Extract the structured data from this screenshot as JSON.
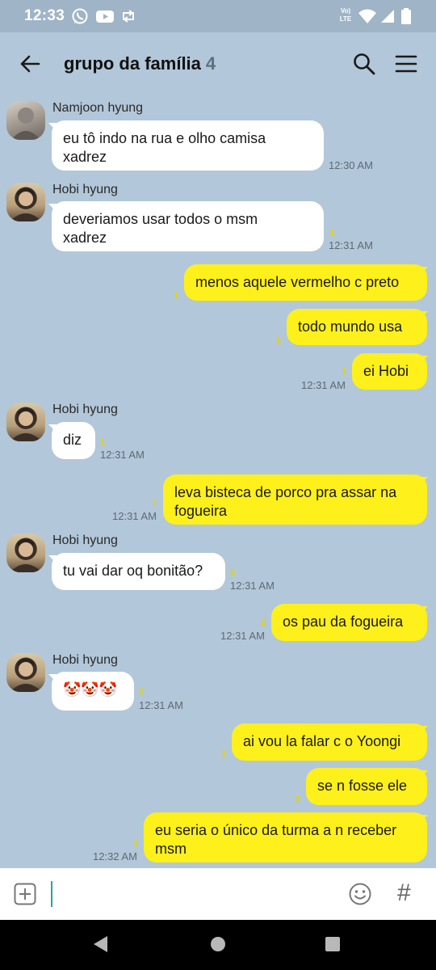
{
  "status_bar": {
    "time": "12:33",
    "network_label": "LTE",
    "icons": [
      "whatsapp-icon",
      "youtube-icon",
      "retweet-icon",
      "volte-icon",
      "wifi-icon",
      "signal-icon",
      "battery-icon"
    ]
  },
  "header": {
    "title": "grupo da família",
    "member_count": "4",
    "icons": [
      "back-arrow-icon",
      "search-icon",
      "menu-icon"
    ]
  },
  "messages": [
    {
      "direction": "in",
      "sender": "Namjoon hyung",
      "lines": [
        "eu tô indo na rua e olho camisa",
        "xadrez"
      ],
      "unread": "",
      "time": "12:30 AM"
    },
    {
      "direction": "in",
      "sender": "Hobi hyung",
      "lines": [
        "deveriamos usar todos o msm",
        "xadrez"
      ],
      "unread": "1",
      "time": "12:31 AM"
    },
    {
      "direction": "out",
      "lines": [
        "menos aquele vermelho c preto"
      ],
      "unread": "1",
      "time": ""
    },
    {
      "direction": "out",
      "lines": [
        "todo mundo usa"
      ],
      "unread": "1",
      "time": ""
    },
    {
      "direction": "out",
      "lines": [
        "ei Hobi"
      ],
      "unread": "1",
      "time": "12:31 AM"
    },
    {
      "direction": "in",
      "sender": "Hobi hyung",
      "lines": [
        "diz"
      ],
      "unread": "1",
      "time": "12:31 AM"
    },
    {
      "direction": "out",
      "lines": [
        "leva bisteca de porco pra assar na",
        "fogueira"
      ],
      "unread": "1",
      "time": "12:31 AM"
    },
    {
      "direction": "in",
      "sender": "Hobi hyung",
      "lines": [
        "tu vai dar oq bonitão?"
      ],
      "unread": "2",
      "time": "12:31 AM"
    },
    {
      "direction": "out",
      "lines": [
        "os pau da fogueira"
      ],
      "unread": "2",
      "time": "12:31 AM"
    },
    {
      "direction": "in",
      "sender": "Hobi hyung",
      "lines": [
        "🤡🤡🤡"
      ],
      "unread": "2",
      "time": "12:31 AM"
    },
    {
      "direction": "out",
      "lines": [
        "ai vou la falar c o Yoongi"
      ],
      "unread": "3",
      "time": ""
    },
    {
      "direction": "out",
      "lines": [
        "se n fosse ele"
      ],
      "unread": "3",
      "time": ""
    },
    {
      "direction": "out",
      "lines": [
        "eu seria o único da turma a n receber",
        "msm"
      ],
      "unread": "3",
      "time": "12:32 AM"
    }
  ],
  "input": {
    "value": "",
    "icons": [
      "plus-square-icon",
      "emoji-icon",
      "hashtag-icon"
    ],
    "hashtag_glyph": "#"
  },
  "colors": {
    "chat_background": "#b2c7d9",
    "outgoing_bubble": "#fef01b",
    "incoming_bubble": "#ffffff",
    "cursor": "#26a69a"
  }
}
